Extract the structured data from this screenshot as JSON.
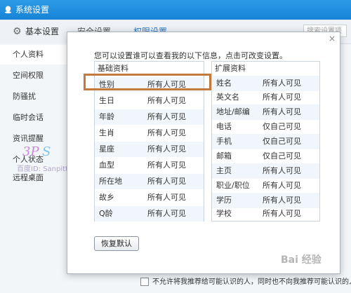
{
  "window": {
    "title": "系统设置"
  },
  "topnav": {
    "tabs": [
      {
        "label": "基本设置",
        "icon": "gear-icon"
      },
      {
        "label": "安全设置"
      },
      {
        "label": "权限设置"
      }
    ],
    "search_text": "搜索设置项"
  },
  "sidebar": {
    "items": [
      {
        "label": "个人资料"
      },
      {
        "label": "空间权限"
      },
      {
        "label": "防骚扰"
      },
      {
        "label": "临时会话"
      },
      {
        "label": "资讯提醒"
      },
      {
        "label": "个人状态"
      },
      {
        "label": "远程桌面"
      }
    ]
  },
  "watermark": {
    "text": "百度ID: Sanpitt"
  },
  "dialog": {
    "intro": "您可以设置谁可以查看我的以下信息，点击可改变设置。",
    "basic": {
      "header": "基础资料",
      "rows": [
        {
          "label": "性别",
          "value": "所有人可见"
        },
        {
          "label": "生日",
          "value": "所有人可见"
        },
        {
          "label": "年龄",
          "value": "所有人可见"
        },
        {
          "label": "生肖",
          "value": "所有人可见"
        },
        {
          "label": "星座",
          "value": "所有人可见"
        },
        {
          "label": "血型",
          "value": "所有人可见"
        },
        {
          "label": "所在地",
          "value": "所有人可见"
        },
        {
          "label": "故乡",
          "value": "所有人可见"
        },
        {
          "label": "Q龄",
          "value": "所有人可见"
        }
      ]
    },
    "extended": {
      "header": "扩展资料",
      "rows": [
        {
          "label": "姓名",
          "value": "所有人可见"
        },
        {
          "label": "英文名",
          "value": "所有人可见"
        },
        {
          "label": "地址/邮编",
          "value": "所有人可见"
        },
        {
          "label": "电话",
          "value": "仅自己可见"
        },
        {
          "label": "手机",
          "value": "仅自己可见"
        },
        {
          "label": "邮箱",
          "value": "仅自己可见"
        },
        {
          "label": "主页",
          "value": "所有人可见"
        },
        {
          "label": "职业/职位",
          "value": "所有人可见"
        },
        {
          "label": "学历",
          "value": "所有人可见"
        },
        {
          "label": "学校",
          "value": "所有人可见"
        }
      ]
    },
    "restore_label": "恢复默认",
    "close_glyph": "×"
  },
  "bottom": {
    "text": "不允许将我推荐给可能认识的人，同时也不向我推荐可能认识的人"
  },
  "baidu_mark": "Bai 经验",
  "colors": {
    "titlebar": "#1683d6",
    "highlight": "#c37a3e",
    "row_alt": "#f0f6fc"
  }
}
